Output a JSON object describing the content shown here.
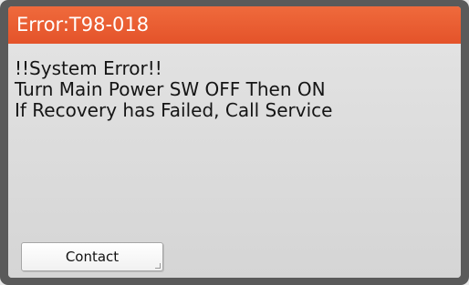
{
  "dialog": {
    "title": "Error:T98-018",
    "message_lines": [
      "!!System Error!!",
      "Turn Main Power SW OFF Then ON",
      "If Recovery has Failed, Call Service"
    ],
    "contact_label": "Contact"
  },
  "colors": {
    "title_bar": "#ea5a2c",
    "frame": "#5a5a5a",
    "dialog_bg": "#dcdcdc"
  }
}
